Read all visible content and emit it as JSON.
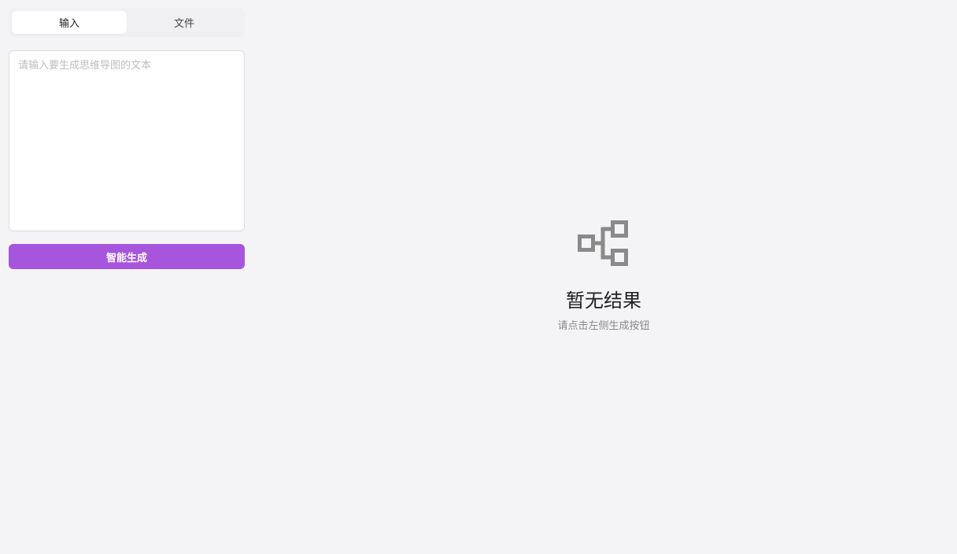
{
  "tabs": [
    {
      "label": "输入",
      "active": true
    },
    {
      "label": "文件",
      "active": false
    }
  ],
  "input": {
    "placeholder": "请输入要生成思维导图的文本",
    "value": ""
  },
  "generate_button": {
    "label": "智能生成",
    "color": "#a855dd"
  },
  "empty_state": {
    "icon": "mindmap-icon",
    "title": "暂无结果",
    "subtitle": "请点击左侧生成按钮"
  }
}
